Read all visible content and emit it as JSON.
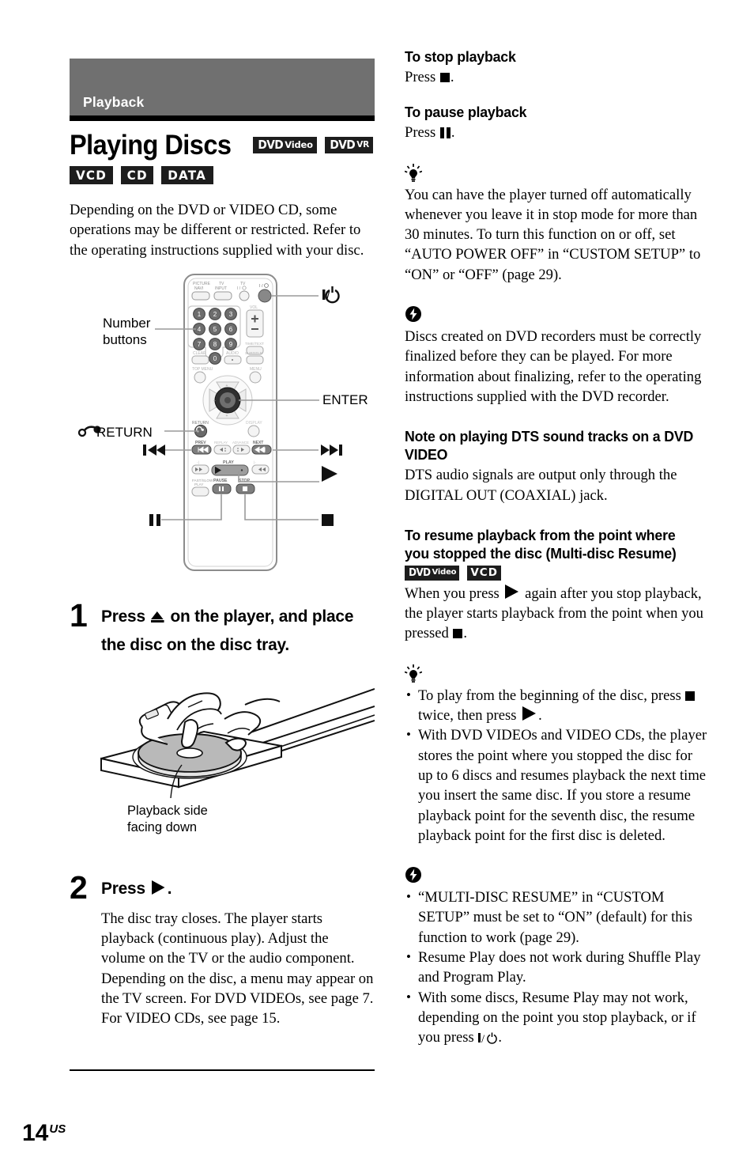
{
  "section": {
    "label": "Playback"
  },
  "title": {
    "text": "Playing Discs",
    "badges_row1": [
      {
        "main": "DVD",
        "sub": "Video"
      },
      {
        "main": "DVD",
        "sub": "VR"
      }
    ],
    "badges_row2": [
      "VCD",
      "CD",
      "DATA"
    ]
  },
  "intro": "Depending on the DVD or VIDEO CD, some operations may be different or restricted. Refer to the operating instructions supplied with your disc.",
  "remote_figure": {
    "callouts": {
      "number_buttons": "Number\nbuttons",
      "number_buttons_l1": "Number",
      "number_buttons_l2": "buttons",
      "return": "RETURN",
      "prev": "prev-track-icon",
      "pause": "pause-icon",
      "power": "power-icon",
      "enter": "ENTER",
      "next": "next-track-icon",
      "play": "play-icon",
      "stop": "stop-icon"
    },
    "button_labels": {
      "picture_navi_l1": "PICTURE",
      "picture_navi_l2": "NAVI",
      "tv_input_l1": "TV",
      "tv_input_l2": "INPUT",
      "tv_power_l1": "TV",
      "tv_power_l2": "I/⏻",
      "power": "I/⏻",
      "vol": "VOL",
      "vol_plus": "+",
      "vol_minus": "−",
      "time_text": "TIME/TEXT",
      "clear": "CLEAR",
      "audio": "AUDIO",
      "subtitle": "SUBTITLE",
      "top_menu": "TOP MENU",
      "menu": "MENU",
      "return": "RETURN",
      "display": "DISPLAY",
      "prev": "PREV",
      "replay": "REPLAY",
      "advance": "ADVANCE",
      "next": "NEXT",
      "play": "PLAY",
      "fast_slow_l1": "FAST/SLOW",
      "fast_slow_l2": "PLAY",
      "pause": "PAUSE",
      "stop": "STOP"
    },
    "number_keys": [
      "1",
      "2",
      "3",
      "4",
      "5",
      "6",
      "7",
      "8",
      "9",
      "0"
    ]
  },
  "steps": [
    {
      "number": "1",
      "title_before": "Press",
      "title_after": "on the player, and place the disc on the disc tray.",
      "glyph": "eject-icon",
      "description": ""
    },
    {
      "number": "2",
      "title_before": "Press",
      "title_after": ".",
      "glyph": "play-icon",
      "description": "The disc tray closes. The player starts playback (continuous play). Adjust the volume on the TV or the audio component.\nDepending on the disc, a menu may appear on the TV screen. For DVD VIDEOs, see page 7. For VIDEO CDs, see page 15."
    }
  ],
  "tray_figure": {
    "caption_l1": "Playback side",
    "caption_l2": "facing down"
  },
  "right_column": {
    "stop_heading": "To stop playback",
    "stop_text_before": "Press",
    "stop_text_after": ".",
    "pause_heading": "To pause playback",
    "pause_text_before": "Press",
    "pause_text_after": ".",
    "tip1": "You can have the player turned off automatically whenever you leave it in stop mode for more than 30 minutes. To turn this function on or off, set “AUTO POWER OFF” in “CUSTOM SETUP” to “ON” or “OFF” (page 29).",
    "note1": "Discs created on DVD recorders must be correctly finalized before they can be played. For more information about finalizing, refer to the operating instructions supplied with the DVD recorder.",
    "dts_heading": "Note on playing DTS sound tracks on a DVD VIDEO",
    "dts_text": "DTS audio signals are output only through the DIGITAL OUT (COAXIAL) jack.",
    "resume_heading": "To resume playback from the point where you stopped the disc (Multi-disc Resume)",
    "resume_badges": [
      {
        "main": "DVD",
        "sub": "Video"
      },
      {
        "main": "VCD",
        "sub": ""
      }
    ],
    "resume_text_a": "When you press",
    "resume_text_b": "again after you stop playback, the player starts playback from the point when you pressed",
    "resume_text_c": ".",
    "tip2_items": [
      {
        "a": "To play from the beginning of the disc, press",
        "b": "twice, then press",
        "c": "."
      },
      {
        "a": "With DVD VIDEOs and VIDEO CDs, the player stores the point where you stopped the disc for up to 6 discs and resumes playback the next time you insert the same disc. If you store a resume playback point for the seventh disc, the resume playback point for the first disc is deleted.",
        "b": "",
        "c": ""
      }
    ],
    "note2_items": [
      "“MULTI-DISC RESUME” in “CUSTOM SETUP” must be set to “ON” (default) for this function to work (page 29).",
      "Resume Play does not work during Shuffle Play and Program Play.",
      "With some discs, Resume Play may not work, depending on the point you stop playback, or if you press"
    ],
    "note2_last_suffix": "."
  },
  "footer": {
    "page_number": "14",
    "region": "US"
  },
  "icons": {
    "tip": "lightbulb-icon",
    "note": "bolt-note-icon",
    "return": "return-arrow-icon"
  },
  "colors": {
    "section_bar": "#707070",
    "badge_bg": "#1d1d1d",
    "rule": "#000000"
  }
}
